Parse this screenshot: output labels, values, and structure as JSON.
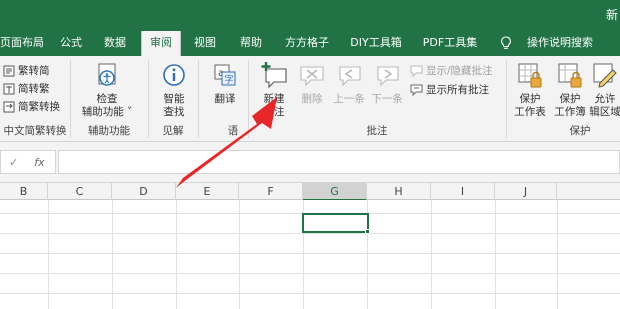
{
  "app": {
    "title_fragment": "新"
  },
  "menu": {
    "tabs": [
      {
        "label": "页面布局"
      },
      {
        "label": "公式"
      },
      {
        "label": "数据"
      },
      {
        "label": "审阅"
      },
      {
        "label": "视图"
      },
      {
        "label": "帮助"
      },
      {
        "label": "方方格子"
      },
      {
        "label": "DIY工具箱"
      },
      {
        "label": "PDF工具集"
      }
    ],
    "active_tab": "审阅",
    "tell_me": "操作说明搜索"
  },
  "ribbon": {
    "chinese_conversion": {
      "items": [
        "繁转简",
        "简转繁",
        "简繁转换"
      ],
      "label": "中文简繁转换"
    },
    "accessibility": {
      "check_line1": "检查",
      "check_line2": "辅助功能 ˅",
      "label": "辅助功能"
    },
    "insights": {
      "smart_line1": "智能",
      "smart_line2": "查找",
      "label": "见解"
    },
    "language": {
      "translate": "翻译",
      "label": "语"
    },
    "comments": {
      "new_line1": "新建",
      "new_line2": "批注",
      "delete": "删除",
      "previous": "上一条",
      "next": "下一条",
      "show_hide": "显示/隐藏批注",
      "show_all": "显示所有批注",
      "label": "批注"
    },
    "protect": {
      "sheet_line1": "保护",
      "sheet_line2": "工作表",
      "workbook_line1": "保护",
      "workbook_line2": "工作簿",
      "allow_line1": "允许",
      "allow_line2": "辑区域",
      "label": "保护"
    }
  },
  "formula_bar": {
    "check_icon": "✓",
    "fx_label": "fx",
    "value": ""
  },
  "grid": {
    "columns": [
      "B",
      "C",
      "D",
      "E",
      "F",
      "G",
      "H",
      "I",
      "J"
    ],
    "selected_column": "G"
  },
  "colors": {
    "brand_green": "#217346",
    "annotation_arrow": "#e8262a"
  }
}
